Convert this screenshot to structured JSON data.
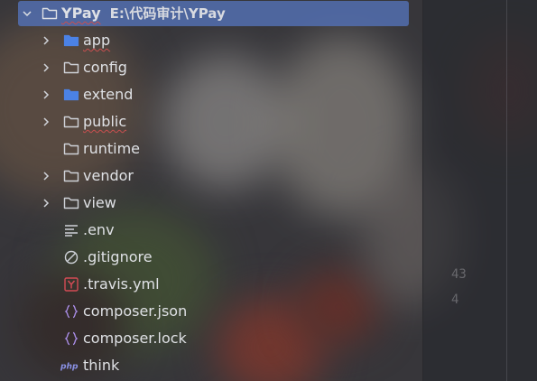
{
  "project": {
    "name": "YPay",
    "path": "E:\\代码审计\\YPay"
  },
  "items": [
    {
      "label": "app",
      "icon": "folder-blue-icon",
      "expandable": true,
      "underline": true
    },
    {
      "label": "config",
      "icon": "folder-icon",
      "expandable": true,
      "underline": false
    },
    {
      "label": "extend",
      "icon": "folder-blue-icon",
      "expandable": true,
      "underline": false
    },
    {
      "label": "public",
      "icon": "folder-icon",
      "expandable": true,
      "underline": true
    },
    {
      "label": "runtime",
      "icon": "folder-icon",
      "expandable": false,
      "underline": false
    },
    {
      "label": "vendor",
      "icon": "folder-icon",
      "expandable": true,
      "underline": false
    },
    {
      "label": "view",
      "icon": "folder-icon",
      "expandable": true,
      "underline": false
    },
    {
      "label": ".env",
      "icon": "lines-file-icon",
      "expandable": false,
      "underline": false
    },
    {
      "label": ".gitignore",
      "icon": "ignore-file-icon",
      "expandable": false,
      "underline": false
    },
    {
      "label": ".travis.yml",
      "icon": "yaml-file-icon",
      "expandable": false,
      "underline": false
    },
    {
      "label": "composer.json",
      "icon": "json-file-icon",
      "expandable": false,
      "underline": false
    },
    {
      "label": "composer.lock",
      "icon": "json-file-icon",
      "expandable": false,
      "underline": false
    },
    {
      "label": "think",
      "icon": "php-file-icon",
      "expandable": false,
      "underline": false
    }
  ],
  "colors": {
    "selection": "#526eb0",
    "text": "#dfe1e5",
    "folder_blue": "#4b82e6",
    "folder_outline": "#cfd2d8",
    "json_icon": "#a98de6",
    "yaml_icon": "#d44b55",
    "php_icon": "#8c93e8"
  }
}
